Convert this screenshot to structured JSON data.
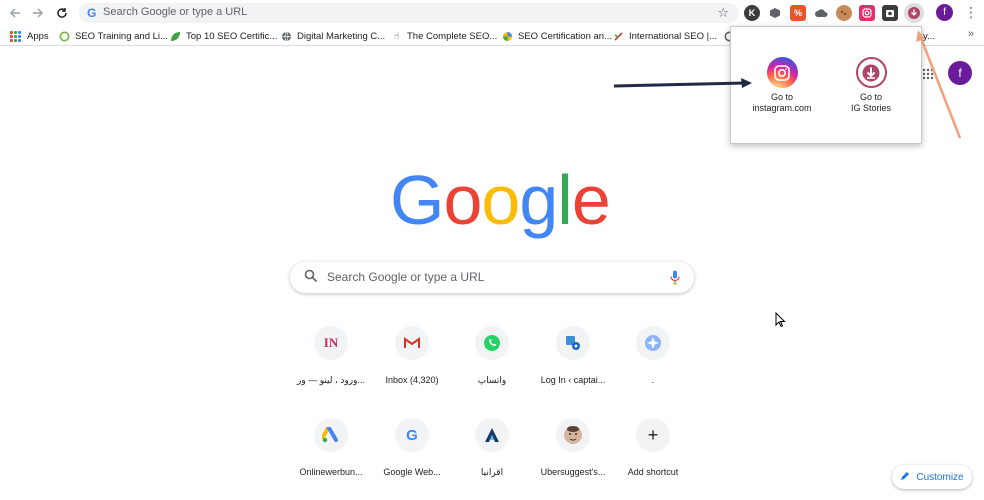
{
  "toolbar": {
    "back_icon": "arrow-left-icon",
    "forward_icon": "arrow-right-icon",
    "reload_icon": "reload-icon",
    "omnibox_text": "Search Google or type a URL",
    "bookmark_icon": "star-icon",
    "extensions": [
      {
        "icon": "k-extension-icon",
        "letter": "K",
        "color": "#3c3c3c"
      },
      {
        "icon": "cube-extension-icon",
        "letter": "",
        "color": "#5f6368"
      },
      {
        "icon": "percent-extension-icon",
        "letter": "%",
        "color": "#e8542b"
      },
      {
        "icon": "cloud-extension-icon",
        "letter": "",
        "color": "#5f6368"
      },
      {
        "icon": "cookie-extension-icon",
        "letter": "",
        "color": "#8d5a2b"
      },
      {
        "icon": "instagram-extension-icon",
        "letter": "",
        "color": "#c13584"
      },
      {
        "icon": "camera-extension-icon",
        "letter": "",
        "color": "#3c3c3c"
      },
      {
        "icon": "ig-download-extension-icon",
        "letter": "",
        "color": "#b0456a"
      }
    ],
    "profile_initial": "f",
    "menu_icon": "three-dots-icon"
  },
  "bookmarks": {
    "items": [
      {
        "label": "Apps",
        "icon": "apps-grid-icon"
      },
      {
        "label": "SEO Training and Li...",
        "icon": "circle-icon"
      },
      {
        "label": "Top 10 SEO Certific...",
        "icon": "leaf-icon"
      },
      {
        "label": "Digital Marketing C...",
        "icon": "globe-icon"
      },
      {
        "label": "The Complete SEO...",
        "icon": "hand-pointer-icon"
      },
      {
        "label": "SEO Certification an...",
        "icon": "colorful-ball-icon"
      },
      {
        "label": "International SEO |...",
        "icon": "arrows-icon"
      }
    ],
    "overflow_icon": "double-chevron-right-icon",
    "partial_label": "y..."
  },
  "popup": {
    "items": [
      {
        "label_line1": "Go to",
        "label_line2": "instagram.com",
        "icon": "instagram-icon"
      },
      {
        "label_line1": "Go to",
        "label_line2": "IG Stories",
        "icon": "download-arrow-icon"
      }
    ]
  },
  "ntp": {
    "profile_initial": "f",
    "logo": {
      "letters": [
        "G",
        "o",
        "o",
        "g",
        "l",
        "e"
      ],
      "colors": [
        "#4285f4",
        "#ea4335",
        "#fbbc05",
        "#4285f4",
        "#34a853",
        "#ea4335"
      ]
    },
    "search_placeholder": "Search Google or type a URL",
    "tiles_row1": [
      {
        "label": "ورود ، لينو — ور...",
        "icon": "in-logo-icon",
        "glyph": "IN",
        "color": "#d7285a"
      },
      {
        "label": "Inbox (4,320)",
        "icon": "gmail-icon",
        "glyph": "M",
        "color": "#d93025"
      },
      {
        "label": "واتساپ",
        "icon": "whatsapp-icon",
        "glyph": "✆",
        "color": "#25d366"
      },
      {
        "label": "Log In ‹ captai...",
        "icon": "site-icon",
        "glyph": "⚙",
        "color": "#3d8fd6"
      },
      {
        "label": ".",
        "icon": "compass-icon",
        "glyph": "✦",
        "color": "#8ab4f8"
      }
    ],
    "tiles_row2": [
      {
        "label": "Onlinewerbun...",
        "icon": "google-ads-icon",
        "glyph": "▲",
        "color": "#4285f4"
      },
      {
        "label": "Google Web...",
        "icon": "google-g-icon",
        "glyph": "G",
        "color": "#4285f4"
      },
      {
        "label": "اقرانیا",
        "icon": "a-logo-icon",
        "glyph": "A",
        "color": "#1a3a6b"
      },
      {
        "label": "Ubersuggest's...",
        "icon": "avatar-face-icon",
        "glyph": "☺",
        "color": "#8d6e63"
      },
      {
        "label": "Add shortcut",
        "icon": "plus-icon",
        "glyph": "+",
        "color": "#202124"
      }
    ],
    "customize_label": "Customize"
  }
}
